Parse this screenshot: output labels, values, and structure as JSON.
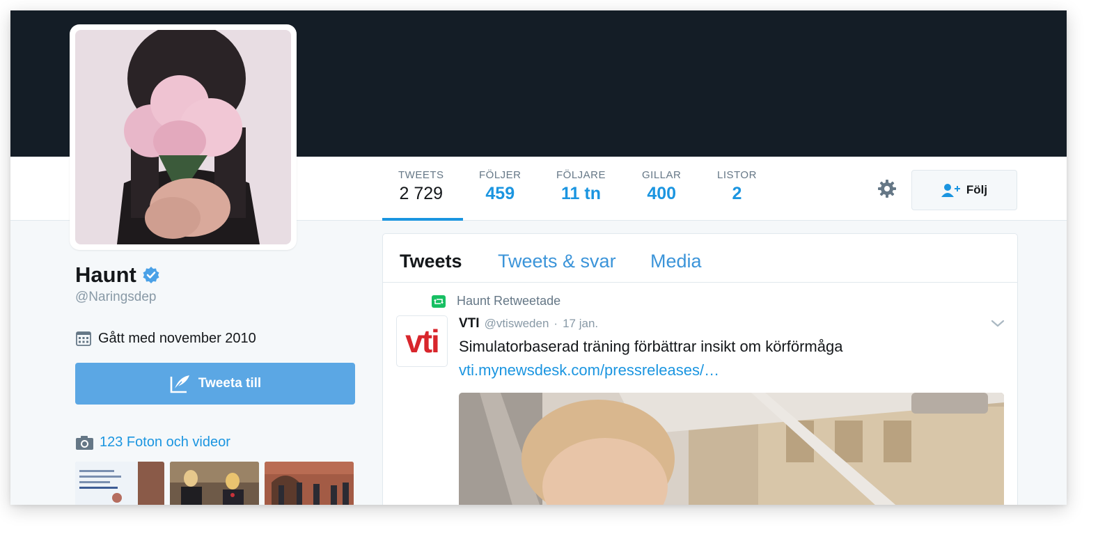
{
  "profile": {
    "name": "Haunt",
    "handle": "@Naringsdep",
    "joined": "Gått med november 2010",
    "verified_icon": "verified-badge-icon"
  },
  "stats": [
    {
      "label": "TWEETS",
      "value": "2 729",
      "active": true
    },
    {
      "label": "FÖLJER",
      "value": "459",
      "active": false
    },
    {
      "label": "FÖLJARE",
      "value": "11 tn",
      "active": false
    },
    {
      "label": "GILLAR",
      "value": "400",
      "active": false
    },
    {
      "label": "LISTOR",
      "value": "2",
      "active": false
    }
  ],
  "actions": {
    "follow_label": "Följ",
    "tweet_to_label": "Tweeta till",
    "photos_label": "123 Foton och videor"
  },
  "timeline": {
    "tabs": [
      {
        "label": "Tweets",
        "active": true
      },
      {
        "label": "Tweets & svar",
        "active": false
      },
      {
        "label": "Media",
        "active": false
      }
    ],
    "tweet": {
      "retweet_context": "Haunt Retweetade",
      "author_name": "VTI",
      "author_handle": "@vtisweden",
      "separator": "·",
      "date": "17 jan.",
      "avatar_text": "vti",
      "text": "Simulatorbaserad träning förbättrar insikt om körförmåga",
      "link": "vti.mynewsdesk.com/pressreleases/…"
    }
  },
  "colors": {
    "banner": "#141d26",
    "accent": "#1b95e0",
    "tweet_button": "#5ba7e4",
    "retweet_green": "#17bf63",
    "vti_red": "#d8262c"
  }
}
